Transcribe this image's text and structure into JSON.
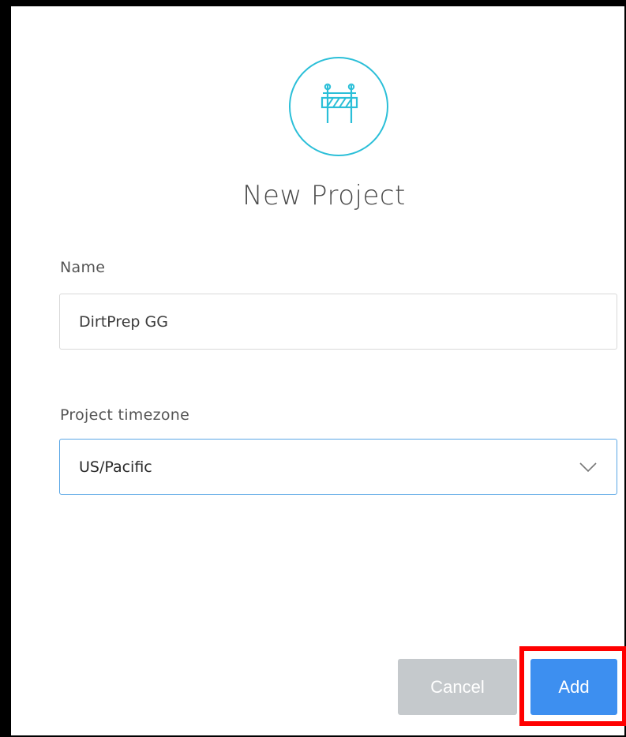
{
  "dialog": {
    "title": "New Project",
    "icon": "construction-barrier-icon",
    "accent_color": "#2bbfd8"
  },
  "form": {
    "name_label": "Name",
    "name_value": "DirtPrep GG",
    "timezone_label": "Project timezone",
    "timezone_value": "US/Pacific"
  },
  "actions": {
    "cancel_label": "Cancel",
    "add_label": "Add",
    "add_color": "#3d8ff0",
    "cancel_color": "#c5c9cc",
    "highlight_color": "#ff0000"
  }
}
